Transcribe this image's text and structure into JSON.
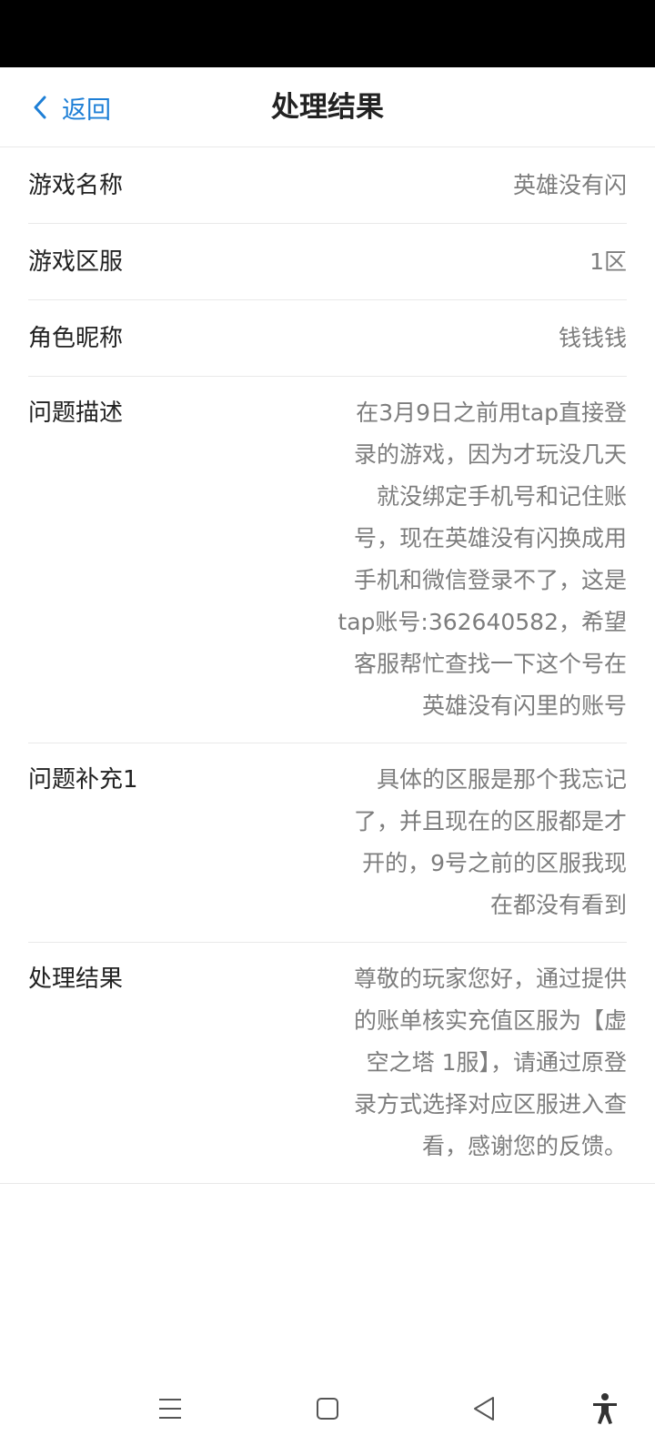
{
  "header": {
    "back_label": "返回",
    "title": "处理结果"
  },
  "rows": [
    {
      "label": "游戏名称",
      "value": "英雄没有闪"
    },
    {
      "label": "游戏区服",
      "value": "1区"
    },
    {
      "label": "角色昵称",
      "value": "钱钱钱"
    }
  ],
  "description": {
    "label": "问题描述",
    "lines": [
      "在3月9日之前用tap直接登",
      "录的游戏，因为才玩没几天",
      "就没绑定手机号和记住账",
      "号，现在英雄没有闪换成用",
      "手机和微信登录不了，这是",
      "tap账号:362640582，希望",
      "客服帮忙查找一下这个号在",
      "英雄没有闪里的账号"
    ]
  },
  "supplement": {
    "label": "问题补充1",
    "lines": [
      "具体的区服是那个我忘记",
      "了，并且现在的区服都是才",
      "开的，9号之前的区服我现",
      "在都没有看到"
    ]
  },
  "result": {
    "label": "处理结果",
    "lines": [
      "尊敬的玩家您好，通过提供",
      "的账单核实充值区服为【虚",
      "空之塔 1服】，请通过原登",
      "录方式选择对应区服进入查",
      "看，感谢您的反馈。"
    ]
  },
  "icons": {
    "back": "chevron-left-icon",
    "menu": "menu-lines-icon",
    "home": "square-home-icon",
    "back_nav": "triangle-back-icon",
    "accessibility": "accessibility-icon"
  },
  "colors": {
    "accent": "#1e7fd6",
    "label_text": "#222222",
    "value_text": "#7d7d7d",
    "divider": "#e9e9e9"
  }
}
